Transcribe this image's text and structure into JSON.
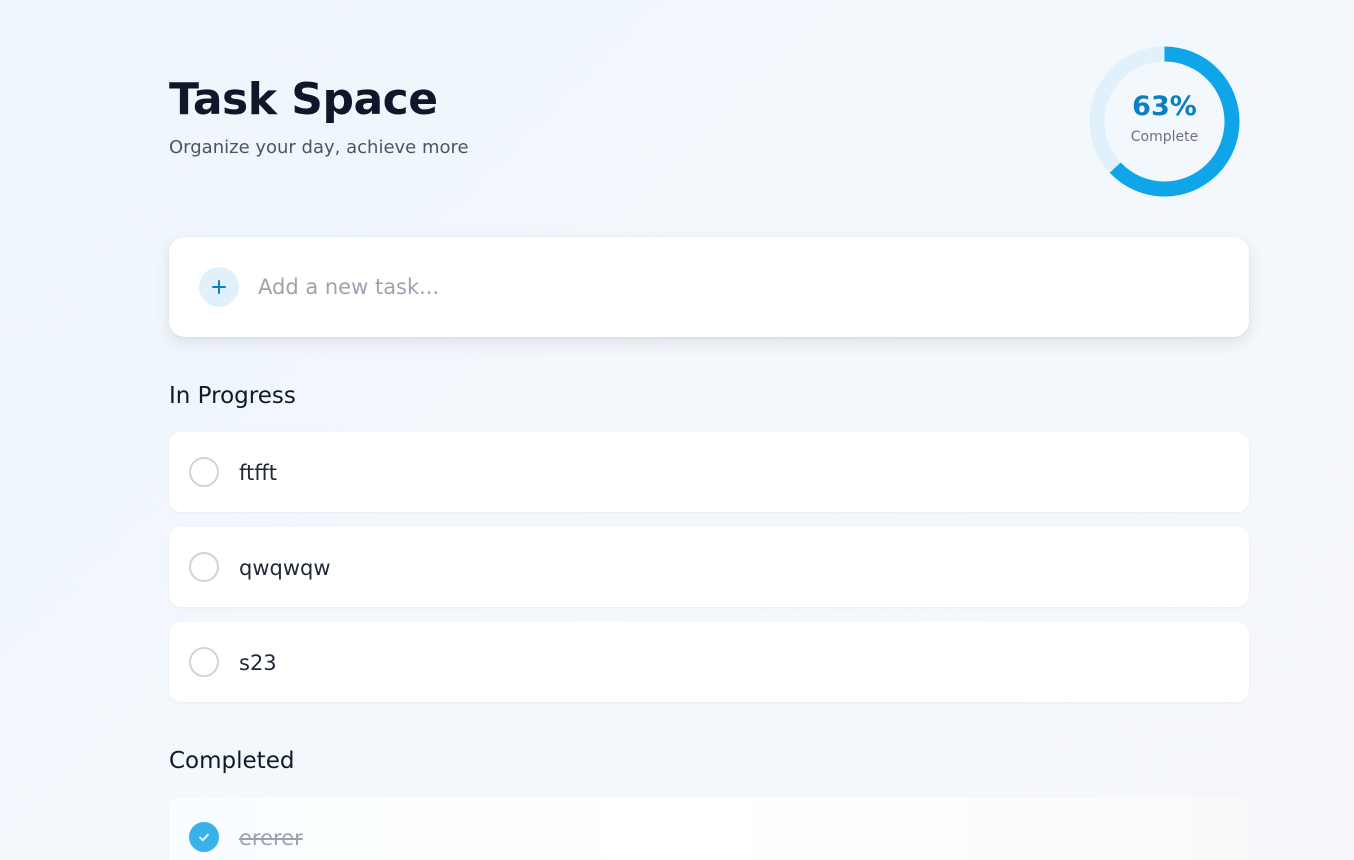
{
  "header": {
    "title": "Task Space",
    "subtitle": "Organize your day, achieve more"
  },
  "progress": {
    "percent": 63,
    "value_text": "63%",
    "label": "Complete"
  },
  "add_task": {
    "placeholder": "Add a new task...",
    "button_icon": "plus-icon"
  },
  "sections": {
    "in_progress": {
      "title": "In Progress",
      "tasks": [
        {
          "text": "ftfft",
          "completed": false
        },
        {
          "text": "qwqwqw",
          "completed": false
        },
        {
          "text": "s23",
          "completed": false
        }
      ]
    },
    "completed": {
      "title": "Completed",
      "tasks": [
        {
          "text": "ererer",
          "completed": true
        }
      ]
    }
  },
  "colors": {
    "accent": "#0ea5e9",
    "accent_dark": "#0b7fc1",
    "ring_track": "#e0f1fc",
    "checkbox_done": "#38b2e8"
  }
}
